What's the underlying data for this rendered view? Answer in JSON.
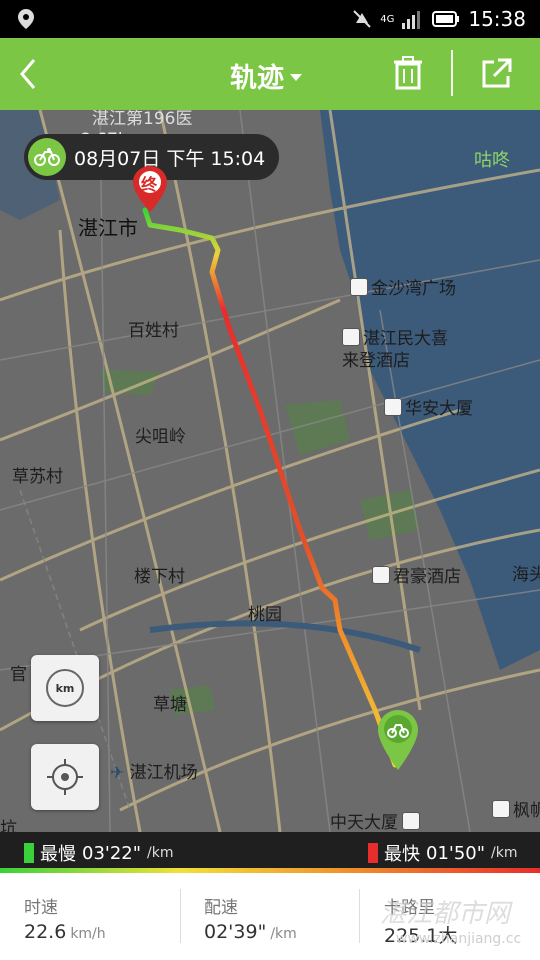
{
  "status_bar": {
    "time": "15:38",
    "network": "4G",
    "icons": [
      "location-icon",
      "mute-icon",
      "signal-icon",
      "battery-icon"
    ]
  },
  "app_bar": {
    "title": "轨迹",
    "icons": [
      "back-icon",
      "trash-icon",
      "share-icon"
    ]
  },
  "map": {
    "date_label": "08月07日 下午 15:04",
    "distance_partial": "8.67km",
    "top_cut_label": "湛江第196医",
    "labels": {
      "city": "湛江市",
      "baixing": "百姓村",
      "jianzhaoling": "尖咀岭",
      "caosu": "草苏村",
      "louxia": "楼下村",
      "taoyuan": "桃园",
      "caotang": "草塘",
      "guan": "官",
      "airport": "湛江机场",
      "jinsha": "金沙湾广场",
      "minda": "湛江民大喜来登酒店",
      "huaan": "华安大厦",
      "junhao": "君豪酒店",
      "zhongtian": "中天大厦",
      "fengfan": "枫帆",
      "haitou": "海头",
      "guli": "咕咚",
      "keng": "坑"
    },
    "end_marker_text": "终",
    "controls": {
      "km_label": "km"
    },
    "route_colors": [
      "#3ad23a",
      "#f0d23a",
      "#f08a2a",
      "#e82d2d"
    ]
  },
  "speed_strip": {
    "slowest_label": "最慢",
    "slowest_value": "03'22\"",
    "slowest_unit": "/km",
    "slowest_color": "#3ad23a",
    "fastest_label": "最快",
    "fastest_value": "01'50\"",
    "fastest_unit": "/km",
    "fastest_color": "#e82d2d"
  },
  "stats": {
    "speed": {
      "label": "时速",
      "value": "22.6",
      "unit": "km/h"
    },
    "pace": {
      "label": "配速",
      "value": "02'39\"",
      "unit": "/km"
    },
    "calories": {
      "label": "卡路里",
      "value": "225.1大"
    }
  },
  "watermark": {
    "main": "湛江都市网",
    "url": "www.zhanjiang.cc"
  },
  "colors": {
    "accent": "#7cc645",
    "map_bg": "#6b6b6b",
    "water": "#3c5a7a"
  }
}
